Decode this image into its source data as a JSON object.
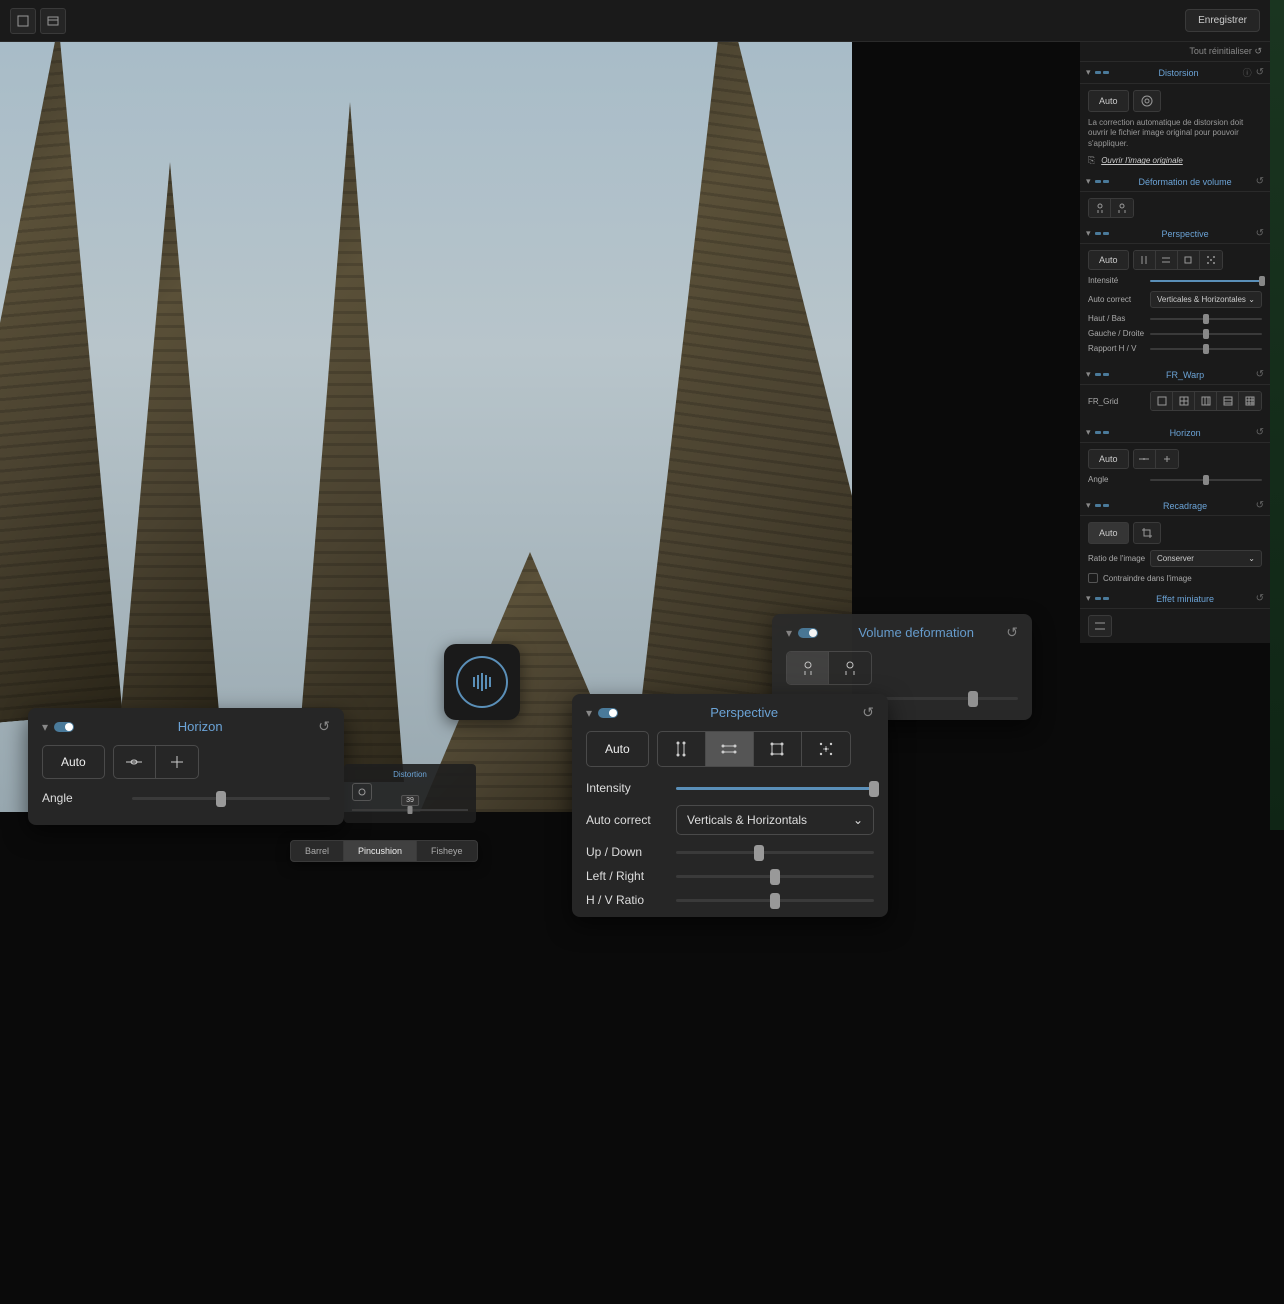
{
  "topbar": {
    "save_label": "Enregistrer"
  },
  "sidebar": {
    "reset_all": "Tout réinitialiser",
    "distortion": {
      "title": "Distorsion",
      "auto": "Auto",
      "info": "La correction automatique de distorsion doit ouvrir le fichier image original pour pouvoir s'appliquer.",
      "open_original": "Ouvrir l'image originale"
    },
    "voldef": {
      "title": "Déformation de volume"
    },
    "perspective": {
      "title": "Perspective",
      "auto": "Auto",
      "intensity": "Intensité",
      "auto_correct": "Auto correct",
      "auto_correct_value": "Verticales & Horizontales",
      "up_down": "Haut / Bas",
      "left_right": "Gauche / Droite",
      "ratio": "Rapport H / V"
    },
    "warp": {
      "title": "FR_Warp",
      "grid": "FR_Grid"
    },
    "horizon": {
      "title": "Horizon",
      "auto": "Auto",
      "angle": "Angle"
    },
    "crop": {
      "title": "Recadrage",
      "auto": "Auto",
      "ratio": "Ratio de l'image",
      "ratio_value": "Conserver",
      "constrain": "Contraindre dans l'image"
    },
    "miniature": {
      "title": "Effet miniature"
    }
  },
  "floating": {
    "horizon": {
      "title": "Horizon",
      "auto": "Auto",
      "angle": "Angle"
    },
    "perspective": {
      "title": "Perspective",
      "auto": "Auto",
      "intensity": "Intensity",
      "auto_correct": "Auto correct",
      "auto_correct_value": "Verticals & Horizontals",
      "up_down": "Up / Down",
      "left_right": "Left / Right",
      "ratio": "H / V Ratio"
    },
    "voldef": {
      "title": "Volume deformation"
    }
  },
  "mini_distortion": {
    "title": "Distortion",
    "value": "39"
  },
  "segments": {
    "barrel": "Barrel",
    "pincushion": "Pincushion",
    "fisheye": "Fisheye"
  }
}
